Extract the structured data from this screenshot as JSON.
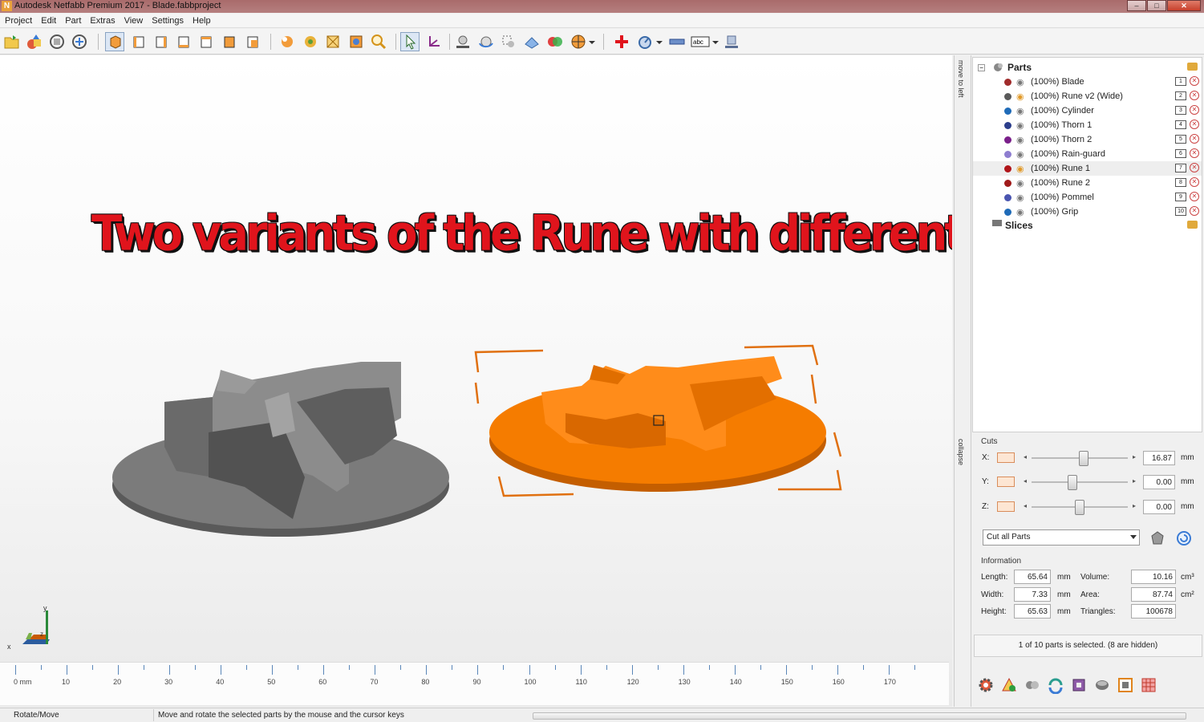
{
  "window": {
    "title": "Autodesk Netfabb Premium 2017 - Blade.fabbproject"
  },
  "menu": [
    "Project",
    "Edit",
    "Part",
    "Extras",
    "View",
    "Settings",
    "Help"
  ],
  "overlay_caption": "Two variants of the Rune with different thickness.",
  "axis": {
    "x": "x",
    "y": "y",
    "z": "z"
  },
  "ruler": {
    "unit_label": "0 mm",
    "ticks": [
      "10",
      "20",
      "30",
      "40",
      "50",
      "60",
      "70",
      "80",
      "90",
      "100",
      "110",
      "120",
      "130",
      "140",
      "150",
      "160",
      "170"
    ]
  },
  "side_tabs": {
    "move": "move to left",
    "collapse": "collapse"
  },
  "tree": {
    "root": "Parts",
    "parts": [
      {
        "label": "(100%) Blade",
        "num": "1",
        "color": "#a02b2b"
      },
      {
        "label": "(100%) Rune v2 (Wide)",
        "num": "2",
        "color": "#5a5a5a"
      },
      {
        "label": "(100%) Cylinder",
        "num": "3",
        "color": "#1f6bb8"
      },
      {
        "label": "(100%) Thorn 1",
        "num": "4",
        "color": "#2c3e8c"
      },
      {
        "label": "(100%) Thorn 2",
        "num": "5",
        "color": "#7a1f8a"
      },
      {
        "label": "(100%) Rain-guard",
        "num": "6",
        "color": "#8e7ed0"
      },
      {
        "label": "(100%) Rune 1",
        "num": "7",
        "color": "#b0151a"
      },
      {
        "label": "(100%) Rune 2",
        "num": "8",
        "color": "#a01a1a"
      },
      {
        "label": "(100%) Pommel",
        "num": "9",
        "color": "#4a55b0"
      },
      {
        "label": "(100%) Grip",
        "num": "10",
        "color": "#1f6bb8"
      }
    ],
    "slices_label": "Slices"
  },
  "cuts": {
    "title": "Cuts",
    "rows": [
      {
        "axis": "X:",
        "value": "16.87",
        "unit": "mm",
        "pos": 0.55
      },
      {
        "axis": "Y:",
        "value": "0.00",
        "unit": "mm",
        "pos": 0.42
      },
      {
        "axis": "Z:",
        "value": "0.00",
        "unit": "mm",
        "pos": 0.5
      }
    ],
    "mode": "Cut all Parts"
  },
  "information": {
    "title": "Information",
    "length_label": "Length:",
    "length": "65.64",
    "length_unit": "mm",
    "width_label": "Width:",
    "width": "7.33",
    "width_unit": "mm",
    "height_label": "Height:",
    "height": "65.63",
    "height_unit": "mm",
    "volume_label": "Volume:",
    "volume": "10.16",
    "volume_unit": "cm³",
    "area_label": "Area:",
    "area": "87.74",
    "area_unit": "cm²",
    "triangles_label": "Triangles:",
    "triangles": "100678"
  },
  "selection_status": "1 of 10 parts is selected. (8 are hidden)",
  "statusbar": {
    "mode": "Rotate/Move",
    "hint": "Move and rotate the selected parts by the mouse and the cursor keys"
  },
  "colors": {
    "selected_part": "#f57c00",
    "unselected_part": "#6e6e6e",
    "caption": "#e0141c"
  }
}
